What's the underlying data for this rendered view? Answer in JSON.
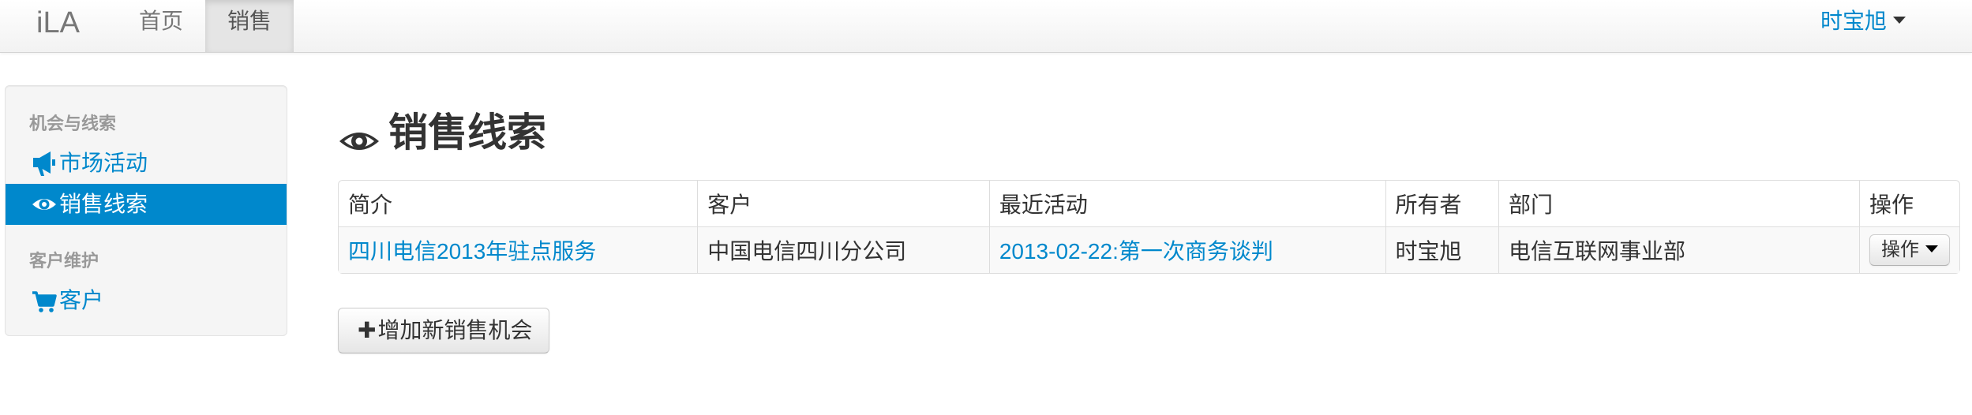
{
  "navbar": {
    "brand": "iLA",
    "nav_items": [
      {
        "label": "首页"
      },
      {
        "label": "销售"
      }
    ],
    "user_name": "时宝旭"
  },
  "sidebar": {
    "groups": [
      {
        "header": "机会与线索",
        "items": [
          {
            "label": "市场活动",
            "icon": "bullhorn-icon"
          },
          {
            "label": "销售线索",
            "icon": "eye-icon",
            "active": true
          }
        ]
      },
      {
        "header": "客户维护",
        "items": [
          {
            "label": "客户",
            "icon": "shopping-cart-icon"
          }
        ]
      }
    ]
  },
  "main": {
    "title": "销售线索",
    "title_icon": "eye-icon",
    "table": {
      "columns": [
        "简介",
        "客户",
        "最近活动",
        "所有者",
        "部门",
        "操作"
      ],
      "rows": [
        {
          "summary": "四川电信2013年驻点服务",
          "customer": "中国电信四川分公司",
          "recent_activity": "2013-02-22:第一次商务谈判",
          "owner": "时宝旭",
          "department": "电信互联网事业部",
          "action_label": "操作"
        }
      ]
    },
    "add_button_label": "增加新销售机会"
  },
  "colors": {
    "link": "#0088cc",
    "active_bg": "#0088cc",
    "muted": "#999999"
  }
}
